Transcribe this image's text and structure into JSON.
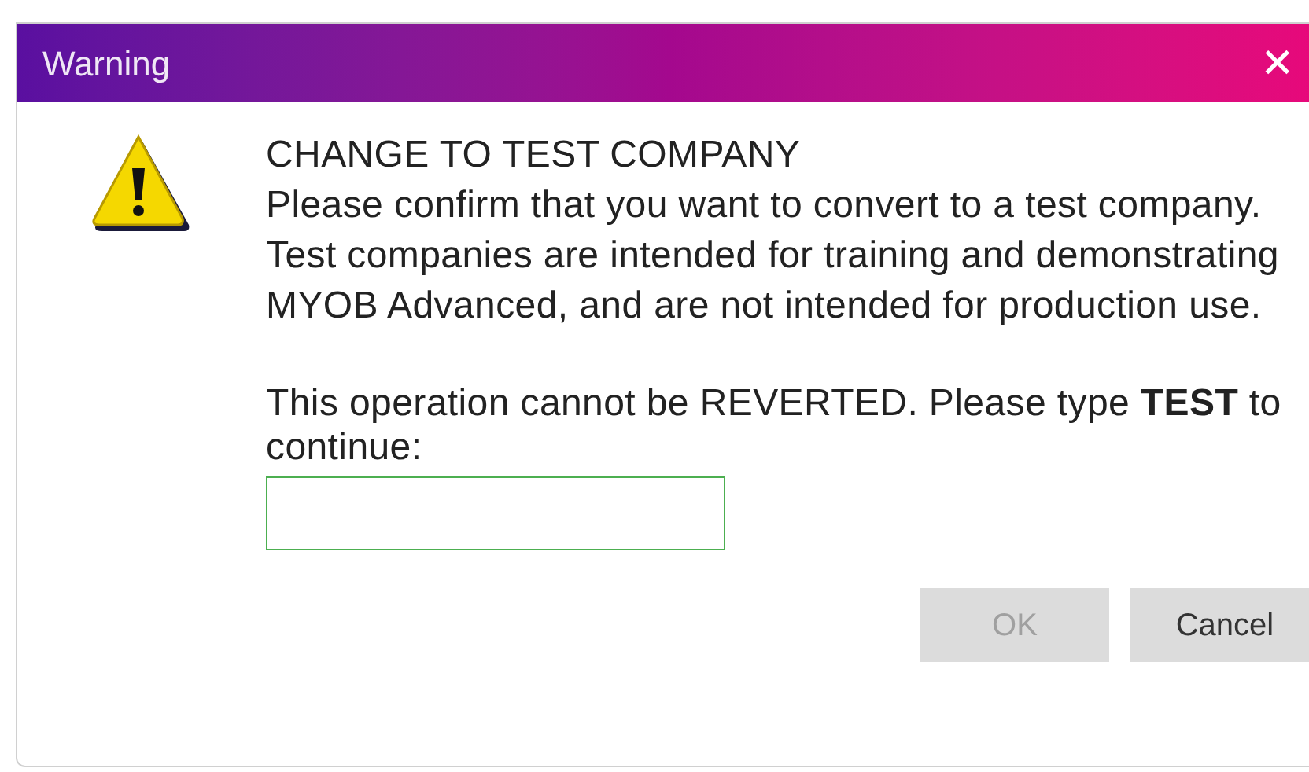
{
  "window": {
    "title": "Warning",
    "close": "✕"
  },
  "message": {
    "heading": "CHANGE TO TEST COMPANY",
    "body": "Please confirm that you want to convert to a test company. Test companies are intended for training and demonstrating MYOB Advanced, and are not intended for production use.",
    "prompt": "This operation cannot be REVERTED. Please type **TEST** to continue:"
  },
  "buttons": [
    {
      "label": "OK",
      "disabled": true
    },
    {
      "label": "Cancel",
      "disabled": false
    }
  ]
}
